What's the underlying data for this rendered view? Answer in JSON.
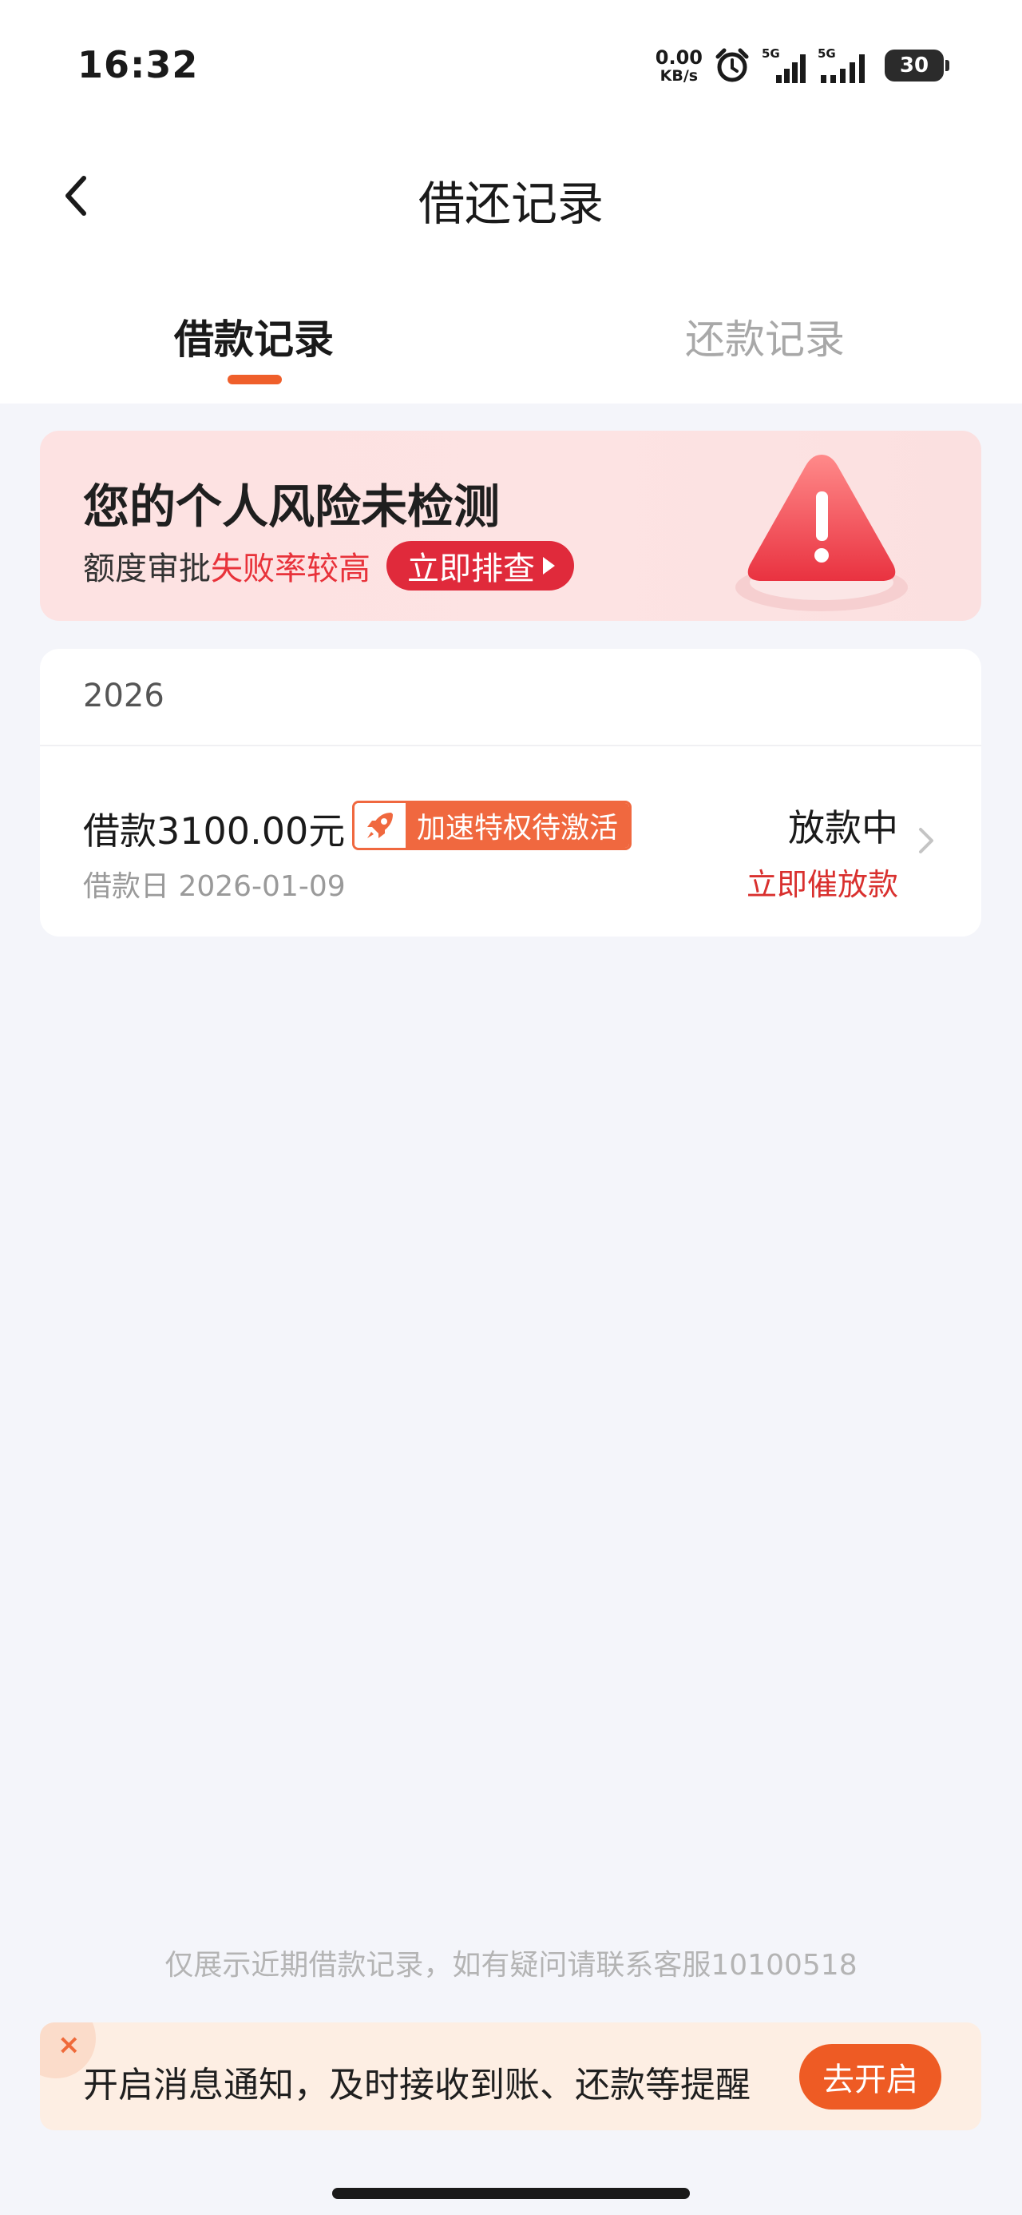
{
  "status_bar": {
    "time": "16:32",
    "net_speed_value": "0.00",
    "net_speed_unit": "KB/s",
    "signal_1_label": "5G",
    "signal_2_label": "5G",
    "battery": "30",
    "icons": [
      "alarm-icon",
      "signal-icon",
      "signal-icon",
      "battery-icon"
    ]
  },
  "header": {
    "title": "借还记录",
    "back_icon": "chevron-left-icon"
  },
  "tabs": [
    {
      "label": "借款记录",
      "active": true
    },
    {
      "label": "还款记录",
      "active": false
    }
  ],
  "risk_banner": {
    "title": "您的个人风险未检测",
    "subtitle_prefix": "额度审批",
    "subtitle_highlight": "失败率较高",
    "button_label": "立即排查",
    "icon": "warning-triangle-icon"
  },
  "records": {
    "year": "2026",
    "items": [
      {
        "amount": "借款3100.00元",
        "badge": "加速特权待激活",
        "badge_icon": "rocket-icon",
        "date": "借款日 2026-01-09",
        "status": "放款中",
        "action": "立即催放款"
      }
    ]
  },
  "footer": {
    "note": "仅展示近期借款记录，如有疑问请联系客服10100518",
    "notify_text": "开启消息通知，及时接收到账、还款等提醒",
    "notify_button": "去开启",
    "close_icon": "close-icon"
  },
  "colors": {
    "accent": "#ef5f2b",
    "danger": "#e02a3b",
    "page_bg": "#f4f5fa"
  }
}
